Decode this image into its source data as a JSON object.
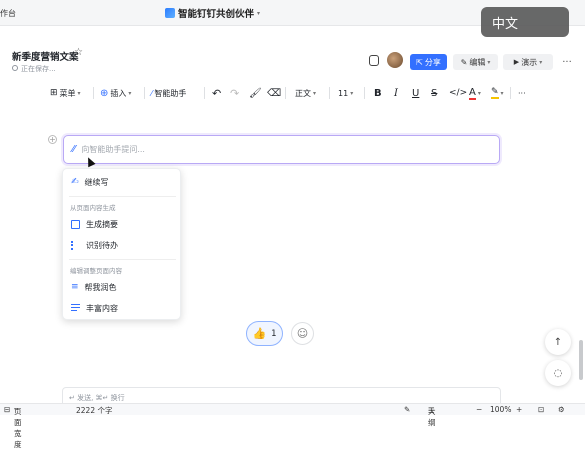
{
  "window": {
    "workspace_label": "作台",
    "app_title": "智能钉钉共创伙伴",
    "language_badge": "中文"
  },
  "doc": {
    "title": "新季度营销文案",
    "save_status": "正在保存..."
  },
  "header_actions": {
    "share": "分享",
    "edit": "编辑",
    "present": "演示",
    "more": "···"
  },
  "toolbar": {
    "menu": "菜单",
    "insert": "插入",
    "ai_assistant": "智能助手",
    "text_style": "正文",
    "font_size": "11",
    "more": "···"
  },
  "ai_input": {
    "placeholder": "向智能助手提问..."
  },
  "ai_menu": {
    "continue_writing": "继续写",
    "section1_header": "从页面内容生成",
    "generate_summary": "生成摘要",
    "identify_todos": "识别待办",
    "section2_header": "编辑调整页面内容",
    "polish": "帮我润色",
    "enrich": "丰富内容"
  },
  "reactions": {
    "like_count": "1"
  },
  "comment": {
    "placeholder": "↵ 发送, ⌘↵ 换行"
  },
  "status_bar": {
    "page_width": "页面宽度",
    "word_count": "2222 个字",
    "outline": "大纲",
    "zoom": "100%"
  },
  "colors": {
    "accent": "#3370ff",
    "ai_border": "#b9a9f5",
    "toolbar_bg": "#f5f6f7"
  }
}
